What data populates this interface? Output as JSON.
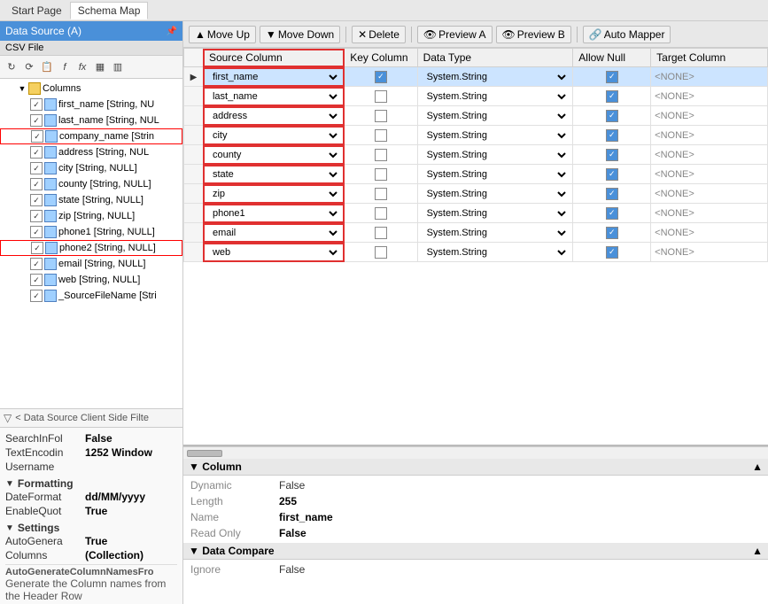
{
  "topbar": {
    "tabs": [
      "Start Page",
      "Schema Map"
    ],
    "active_tab": "Schema Map"
  },
  "left_panel": {
    "title": "Data Source (A)",
    "subtitle": "CSV File",
    "toolbar_buttons": [
      "↻",
      "⟳",
      "📋",
      "f",
      "fx",
      "📋",
      "📋"
    ],
    "tree": {
      "root": {
        "label": "Columns",
        "expanded": true,
        "items": [
          {
            "label": "first_name [String, NU",
            "checked": true,
            "selected": false
          },
          {
            "label": "last_name [String, NUL",
            "checked": true,
            "selected": false
          },
          {
            "label": "company_name [Strin",
            "checked": true,
            "selected": false,
            "highlighted": true
          },
          {
            "label": "address [String, NUL",
            "checked": true,
            "selected": false
          },
          {
            "label": "city [String, NULL]",
            "checked": true,
            "selected": false
          },
          {
            "label": "county [String, NULL]",
            "checked": true,
            "selected": false
          },
          {
            "label": "state [String, NULL]",
            "checked": true,
            "selected": false
          },
          {
            "label": "zip [String, NULL]",
            "checked": true,
            "selected": false
          },
          {
            "label": "phone1 [String, NULL]",
            "checked": true,
            "selected": false
          },
          {
            "label": "phone2 [String, NULL]",
            "checked": true,
            "selected": false,
            "highlighted": true
          },
          {
            "label": "email [String, NULL]",
            "checked": true,
            "selected": false
          },
          {
            "label": "web [String, NULL]",
            "checked": true,
            "selected": false
          },
          {
            "label": "_SourceFileName [Stri",
            "checked": true,
            "selected": false
          }
        ]
      }
    },
    "filter_text": "< Data Source Client Side Filte",
    "properties": [
      {
        "type": "prop",
        "key": "SearchInFol",
        "value": "False"
      },
      {
        "type": "prop",
        "key": "TextEncodin",
        "value": "1252  Window"
      },
      {
        "type": "prop",
        "key": "Username",
        "value": ""
      },
      {
        "type": "section",
        "label": "Formatting"
      },
      {
        "type": "prop",
        "key": "DateFormat",
        "value": "dd/MM/yyyy"
      },
      {
        "type": "prop",
        "key": "EnableQuot",
        "value": "True"
      },
      {
        "type": "section",
        "label": "Settings"
      },
      {
        "type": "prop",
        "key": "AutoGenera",
        "value": "True"
      },
      {
        "type": "prop",
        "key": "Columns",
        "value": "(Collection)"
      }
    ],
    "desc_label": "AutoGenerateColumnNamesFro",
    "desc_text": "Generate the Column names from the Header Row"
  },
  "right_panel": {
    "toolbar": {
      "move_up": "Move Up",
      "move_down": "Move Down",
      "delete": "Delete",
      "preview_a": "Preview A",
      "preview_b": "Preview B",
      "auto_mapper": "Auto Mapper"
    },
    "grid": {
      "headers": [
        "",
        "Source Column",
        "Key Column",
        "Data Type",
        "Allow Null",
        "Target Column"
      ],
      "rows": [
        {
          "id": 1,
          "source": "first_name",
          "key": true,
          "datatype": "System.String",
          "allownull": true,
          "target": "<NONE>",
          "selected": true
        },
        {
          "id": 2,
          "source": "last_name",
          "key": false,
          "datatype": "System.String",
          "allownull": true,
          "target": "<NONE>"
        },
        {
          "id": 3,
          "source": "address",
          "key": false,
          "datatype": "System.String",
          "allownull": true,
          "target": "<NONE>"
        },
        {
          "id": 4,
          "source": "city",
          "key": false,
          "datatype": "System.String",
          "allownull": true,
          "target": "<NONE>"
        },
        {
          "id": 5,
          "source": "county",
          "key": false,
          "datatype": "System.String",
          "allownull": true,
          "target": "<NONE>"
        },
        {
          "id": 6,
          "source": "state",
          "key": false,
          "datatype": "System.String",
          "allownull": true,
          "target": "<NONE>"
        },
        {
          "id": 7,
          "source": "zip",
          "key": false,
          "datatype": "System.String",
          "allownull": true,
          "target": "<NONE>"
        },
        {
          "id": 8,
          "source": "phone1",
          "key": false,
          "datatype": "System.String",
          "allownull": true,
          "target": "<NONE>"
        },
        {
          "id": 9,
          "source": "email",
          "key": false,
          "datatype": "System.String",
          "allownull": true,
          "target": "<NONE>"
        },
        {
          "id": 10,
          "source": "web",
          "key": false,
          "datatype": "System.String",
          "allownull": true,
          "target": "<NONE>"
        }
      ],
      "source_column_highlighted": true
    },
    "bottom_sections": [
      {
        "title": "Column",
        "rows": [
          {
            "key": "Dynamic",
            "value": "False"
          },
          {
            "key": "Length",
            "value": "255",
            "bold": true
          },
          {
            "key": "Name",
            "value": "first_name",
            "bold": true
          },
          {
            "key": "Read Only",
            "value": "False",
            "bold": true
          }
        ]
      },
      {
        "title": "Data Compare",
        "rows": [
          {
            "key": "Ignore",
            "value": "False"
          }
        ]
      }
    ]
  }
}
